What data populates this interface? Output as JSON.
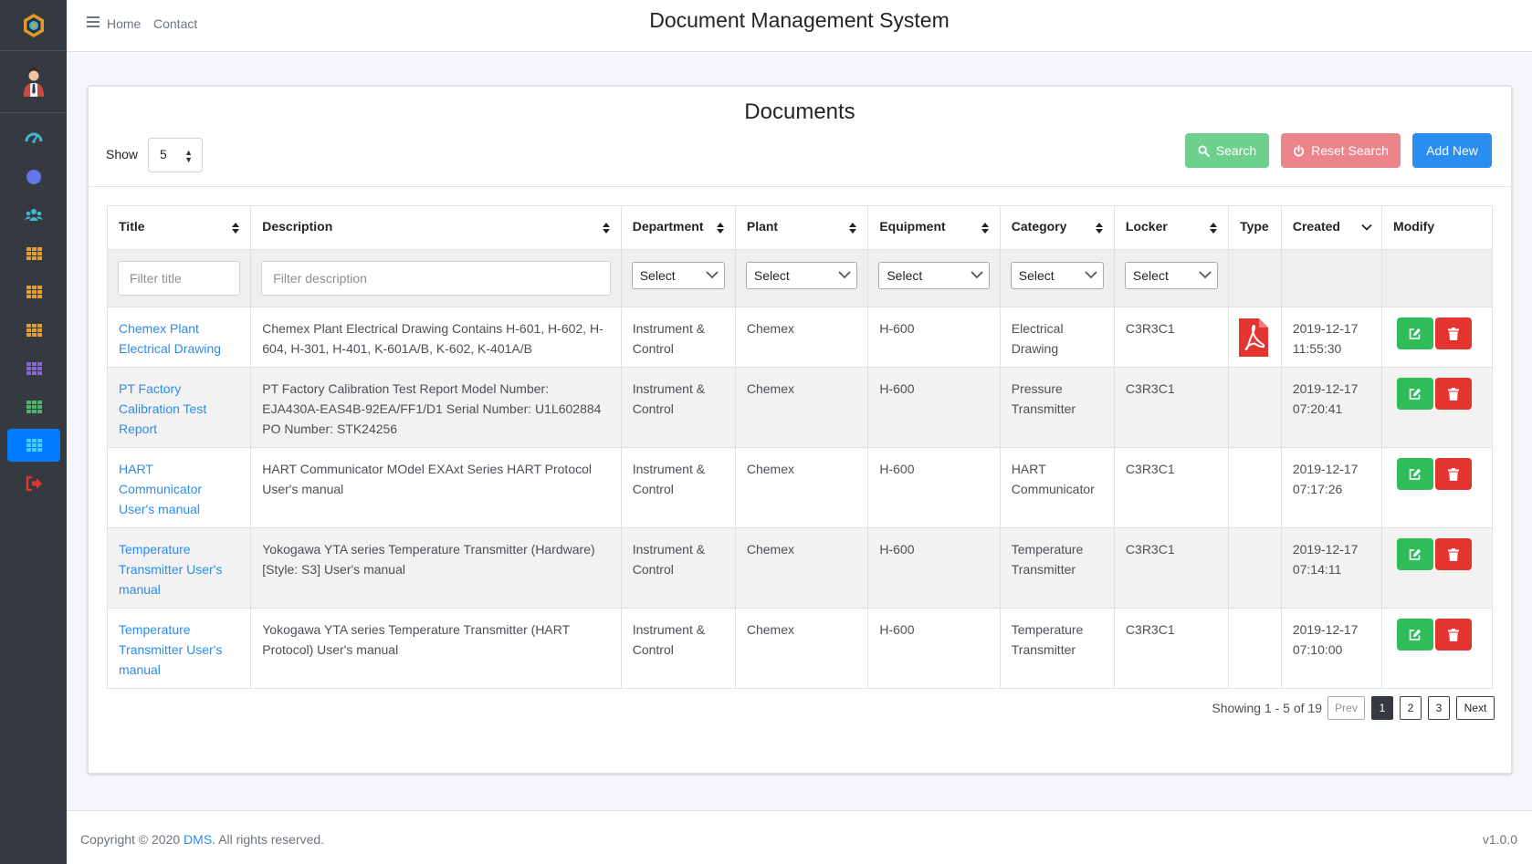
{
  "app_title": "Document Management System",
  "nav": {
    "home": "Home",
    "contact": "Contact"
  },
  "sidebar": {
    "items": [
      {
        "icon": "dashboard-icon",
        "color": "#3fb7d1"
      },
      {
        "icon": "circle-icon",
        "color": "#6674ea"
      },
      {
        "icon": "users-icon",
        "color": "#3fb7d1"
      },
      {
        "icon": "grid-icon",
        "color": "#f29a1b"
      },
      {
        "icon": "grid-icon",
        "color": "#f29a1b"
      },
      {
        "icon": "grid-icon",
        "color": "#f29a1b"
      },
      {
        "icon": "grid-icon",
        "color": "#8a5fea"
      },
      {
        "icon": "grid-icon",
        "color": "#3fbf5c"
      },
      {
        "icon": "grid-icon",
        "color": "#3fb7d1"
      },
      {
        "icon": "logout-icon",
        "color": "#e3342f"
      }
    ],
    "active_index": 8
  },
  "card": {
    "title": "Documents",
    "show_label": "Show",
    "page_size": "5",
    "search_label": "Search",
    "reset_label": "Reset Search",
    "add_label": "Add New"
  },
  "table": {
    "columns": [
      "Title",
      "Description",
      "Department",
      "Plant",
      "Equipment",
      "Category",
      "Locker",
      "Type",
      "Created",
      "Modify"
    ],
    "filters": {
      "title_placeholder": "Filter title",
      "description_placeholder": "Filter description",
      "department": "Select",
      "plant": "Select",
      "equipment": "Select",
      "category": "Select",
      "locker": "Select"
    },
    "rows": [
      {
        "title": "Chemex Plant Electrical Drawing",
        "description": "Chemex Plant Electrical Drawing Contains H-601, H-602, H-604, H-301, H-401, K-601A/B, K-602, K-401A/B",
        "department": "Instrument & Control",
        "plant": "Chemex",
        "equipment": "H-600",
        "category": "Electrical Drawing",
        "locker": "C3R3C1",
        "type": "pdf",
        "created_date": "2019-12-17",
        "created_time": "11:55:30"
      },
      {
        "title": "PT Factory Calibration Test Report",
        "description": "PT Factory Calibration Test Report Model Number: EJA430A-EAS4B-92EA/FF1/D1 Serial Number: U1L602884 PO Number: STK24256",
        "department": "Instrument & Control",
        "plant": "Chemex",
        "equipment": "H-600",
        "category": "Pressure Transmitter",
        "locker": "C3R3C1",
        "type": "",
        "created_date": "2019-12-17",
        "created_time": "07:20:41"
      },
      {
        "title": "HART Communicator User's manual",
        "description": "HART Communicator MOdel EXAxt Series HART Protocol User's manual",
        "department": "Instrument & Control",
        "plant": "Chemex",
        "equipment": "H-600",
        "category": "HART Communicator",
        "locker": "C3R3C1",
        "type": "",
        "created_date": "2019-12-17",
        "created_time": "07:17:26"
      },
      {
        "title": "Temperature Transmitter User's manual",
        "description": "Yokogawa YTA series Temperature Transmitter (Hardware) [Style: S3] User's manual",
        "department": "Instrument & Control",
        "plant": "Chemex",
        "equipment": "H-600",
        "category": "Temperature Transmitter",
        "locker": "C3R3C1",
        "type": "",
        "created_date": "2019-12-17",
        "created_time": "07:14:11"
      },
      {
        "title": "Temperature Transmitter User's manual",
        "description": "Yokogawa YTA series Temperature Transmitter (HART Protocol) User's manual",
        "department": "Instrument & Control",
        "plant": "Chemex",
        "equipment": "H-600",
        "category": "Temperature Transmitter",
        "locker": "C3R3C1",
        "type": "",
        "created_date": "2019-12-17",
        "created_time": "07:10:00"
      }
    ]
  },
  "pagination": {
    "info": "Showing 1 - 5 of 19",
    "prev": "Prev",
    "pages": [
      "1",
      "2",
      "3"
    ],
    "current": "1",
    "next": "Next"
  },
  "footer": {
    "copyright_prefix": "Copyright © 2020 ",
    "brand": "DMS.",
    "rights": " All rights reserved.",
    "version": "v1.0.0"
  },
  "colors": {
    "search": "#6dd08c",
    "reset": "#ec848b",
    "add": "#2a8ef0",
    "edit": "#2ebd59",
    "delete": "#e3342f",
    "link": "#2c8cec",
    "sidebar": "#343a40"
  }
}
